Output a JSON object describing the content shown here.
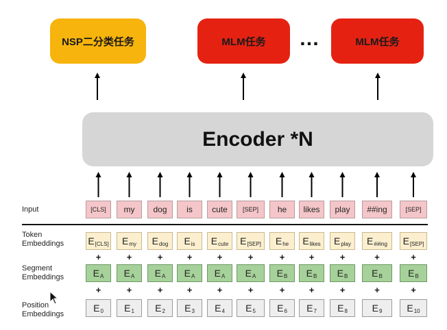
{
  "tasks": {
    "nsp_label": "NSP二分类任务",
    "mlm_label": "MLM任务",
    "ellipsis": "…"
  },
  "encoder": {
    "label": "Encoder *N"
  },
  "rows": {
    "input_label": "Input",
    "token_label_1": "Token",
    "token_label_2": "Embeddings",
    "segment_label_1": "Segment",
    "segment_label_2": "Embeddings",
    "position_label_1": "Position",
    "position_label_2": "Embeddings"
  },
  "tokens": [
    {
      "input": "[CLS]",
      "token_sub": "[CLS]",
      "segment_sub": "A",
      "position_sub": "0"
    },
    {
      "input": "my",
      "token_sub": "my",
      "segment_sub": "A",
      "position_sub": "1"
    },
    {
      "input": "dog",
      "token_sub": "dog",
      "segment_sub": "A",
      "position_sub": "2"
    },
    {
      "input": "is",
      "token_sub": "is",
      "segment_sub": "A",
      "position_sub": "3"
    },
    {
      "input": "cute",
      "token_sub": "cute",
      "segment_sub": "A",
      "position_sub": "4"
    },
    {
      "input": "[SEP]",
      "token_sub": "[SEP]",
      "segment_sub": "A",
      "position_sub": "5"
    },
    {
      "input": "he",
      "token_sub": "he",
      "segment_sub": "B",
      "position_sub": "6"
    },
    {
      "input": "likes",
      "token_sub": "likes",
      "segment_sub": "B",
      "position_sub": "7"
    },
    {
      "input": "play",
      "token_sub": "play",
      "segment_sub": "B",
      "position_sub": "8"
    },
    {
      "input": "##ing",
      "token_sub": "##ing",
      "segment_sub": "B",
      "position_sub": "9"
    },
    {
      "input": "[SEP]",
      "token_sub": "[SEP]",
      "segment_sub": "B",
      "position_sub": "10"
    }
  ],
  "embedding_letter": "E",
  "plus_sign": "+",
  "colors": {
    "nsp": "#f7b40c",
    "mlm": "#e52212",
    "encoder": "#d6d6d6",
    "input": "#f4c6c9",
    "token": "#fbefcf",
    "segment": "#a6d19a",
    "position": "#eeeeee"
  }
}
